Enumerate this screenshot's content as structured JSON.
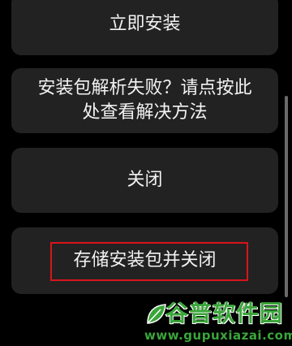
{
  "dialog": {
    "buttons": {
      "install": "立即安装",
      "parse_failed": "安装包解析失败？请点按此处查看解决方法",
      "close": "关闭",
      "save_and_close": "存储安装包并关闭"
    }
  },
  "watermark": {
    "title": "谷普软件园",
    "url": "www.gupuxiazai.com"
  },
  "colors": {
    "background": "#000000",
    "button_bg": "#222222",
    "button_text": "#f2f2f2",
    "highlight": "#d9141b",
    "watermark": "#3aa63a"
  }
}
